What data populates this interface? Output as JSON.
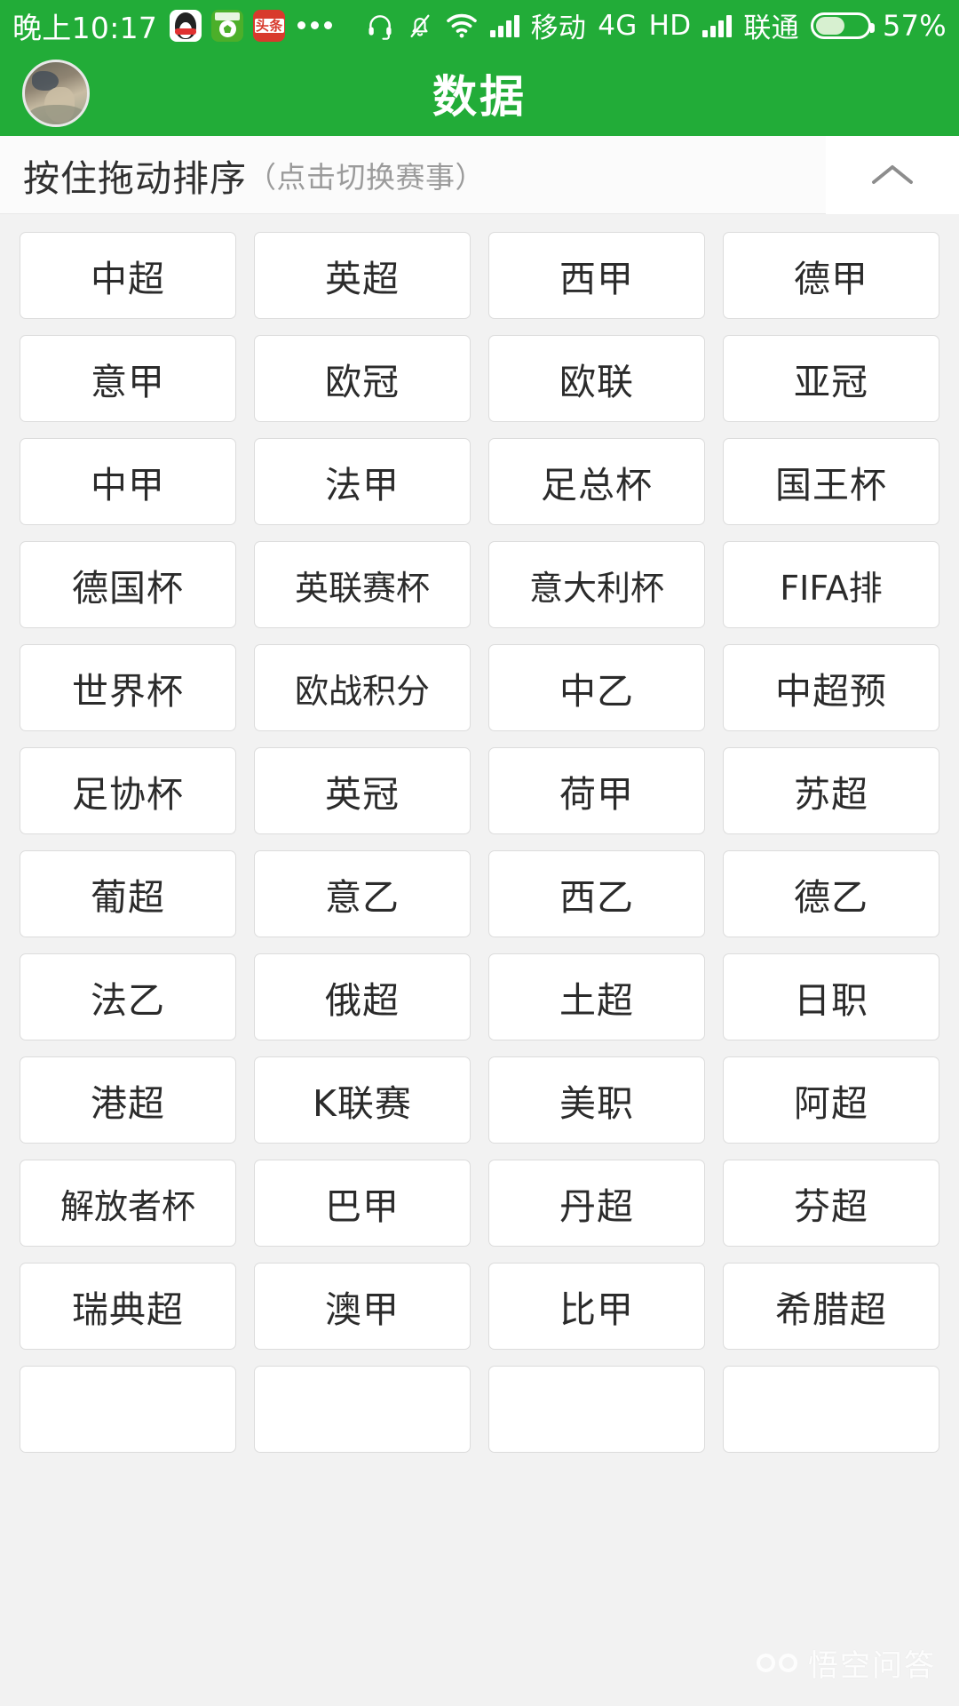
{
  "status_bar": {
    "time": "晚上10:17",
    "app_icons": [
      "qq-icon",
      "soccer-app-icon",
      "toutiao-icon"
    ],
    "overflow": "more-icon",
    "headset_icon": "headset-icon",
    "silent_icon": "bell-muted-icon",
    "wifi_icon": "wifi-icon",
    "carrier_1": "移动",
    "network_type": "4G",
    "hd": "HD",
    "carrier_2": "联通",
    "battery_percent": "57%",
    "battery_level": 57
  },
  "app_bar": {
    "title": "数据",
    "avatar": "user-avatar"
  },
  "section_header": {
    "main_text": "按住拖动排序",
    "sub_text": "（点击切换赛事）",
    "collapse_icon": "chevron-up-icon"
  },
  "watermark": {
    "text": "悟空问答"
  },
  "colors": {
    "brand_green": "#22ac38",
    "page_background": "#f2f2f2",
    "cell_background": "#ffffff",
    "cell_border": "#dcdcdc",
    "text_primary": "#2b2b2b",
    "text_secondary": "#9b9b9b"
  },
  "leagues": [
    "中超",
    "英超",
    "西甲",
    "德甲",
    "意甲",
    "欧冠",
    "欧联",
    "亚冠",
    "中甲",
    "法甲",
    "足总杯",
    "国王杯",
    "德国杯",
    "英联赛杯",
    "意大利杯",
    "FIFA排",
    "世界杯",
    "欧战积分",
    "中乙",
    "中超预",
    "足协杯",
    "英冠",
    "荷甲",
    "苏超",
    "葡超",
    "意乙",
    "西乙",
    "德乙",
    "法乙",
    "俄超",
    "土超",
    "日职",
    "港超",
    "K联赛",
    "美职",
    "阿超",
    "解放者杯",
    "巴甲",
    "丹超",
    "芬超",
    "瑞典超",
    "澳甲",
    "比甲",
    "希腊超",
    "",
    "",
    "",
    ""
  ]
}
